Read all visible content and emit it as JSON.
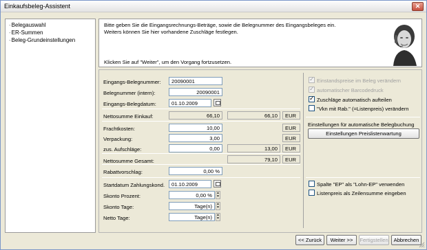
{
  "window": {
    "title": "Einkaufsbeleg-Assistent"
  },
  "nav": {
    "items": [
      "Belegauswahl",
      "ER-Summen",
      "Beleg-Grundeinstellungen"
    ]
  },
  "header": {
    "line1": "Bitte geben Sie die Eingangsrechnungs-Beträge, sowie die Belegnummer des Eingangsbeleges ein.",
    "line2": "Weiters können Sie hier vorhandene Zuschläge festlegen.",
    "line3": "Klicken Sie auf \"Weiter\", um den Vorgang fortzusetzen."
  },
  "form": {
    "eingangs_belegnummer": {
      "label": "Eingangs-Belegnummer:",
      "value": "20090001"
    },
    "belegnummer_intern": {
      "label": "Belegnummer (intern):",
      "value": "20090001"
    },
    "eingangs_belegdatum": {
      "label": "Eingangs-Belegdatum:",
      "value": "01.10.2009"
    },
    "nettosumme_einkauf": {
      "label": "Nettosumme Einkauf:",
      "value": "66,10",
      "value2": "66,10",
      "currency": "EUR"
    },
    "frachtkosten": {
      "label": "Frachtkosten:",
      "value": "10,00",
      "currency": "EUR"
    },
    "verpackung": {
      "label": "Verpackung:",
      "value": "3,00",
      "currency": "EUR"
    },
    "zus_aufschlaege": {
      "label": "zus. Aufschläge:",
      "value": "0,00",
      "value2": "13,00",
      "currency": "EUR"
    },
    "nettosumme_gesamt": {
      "label": "Nettosumme Gesamt:",
      "value": "79,10",
      "currency": "EUR"
    },
    "rabattvorschlag": {
      "label": "Rabattvorschlag:",
      "value": "0,00 %"
    },
    "startdatum": {
      "label": "Startdatum Zahlungskond.",
      "value": "01.10.2009"
    },
    "skonto_prozent": {
      "label": "Skonto Prozent:",
      "value": "0,00 %"
    },
    "skonto_tage": {
      "label": "Skonto Tage:",
      "value": "Tage(n)"
    },
    "netto_tage": {
      "label": "Netto Tage:",
      "value": "Tage(n)"
    }
  },
  "options": {
    "einstandspreise": {
      "label": "Einstandspreise im Beleg verändern",
      "checked": true,
      "enabled": false
    },
    "barcode": {
      "label": "automatischer Barcodedruck",
      "checked": true,
      "enabled": false
    },
    "zuschlaege": {
      "label": "Zuschläge automatisch aufteilen",
      "checked": true,
      "enabled": true
    },
    "vkn": {
      "label": "\"Vkn mit Rab.\" (=Listenpreis) verändern",
      "checked": false,
      "enabled": true
    },
    "auto_heading": "Einstellungen für automatische Belegbuchung",
    "preislisten_button": "Einstellungen Preislistenwartung",
    "spalte_ep": {
      "label": "Spalte \"EP\" als \"Lohn-EP\" verwenden",
      "checked": false
    },
    "listenpreis": {
      "label": "Listenpreis als Zeilensumme eingeben",
      "checked": false
    }
  },
  "footer": {
    "back": "<< Zurück",
    "next": "Weiter >>",
    "finish": "Fertigstellen",
    "cancel": "Abbrechen"
  }
}
